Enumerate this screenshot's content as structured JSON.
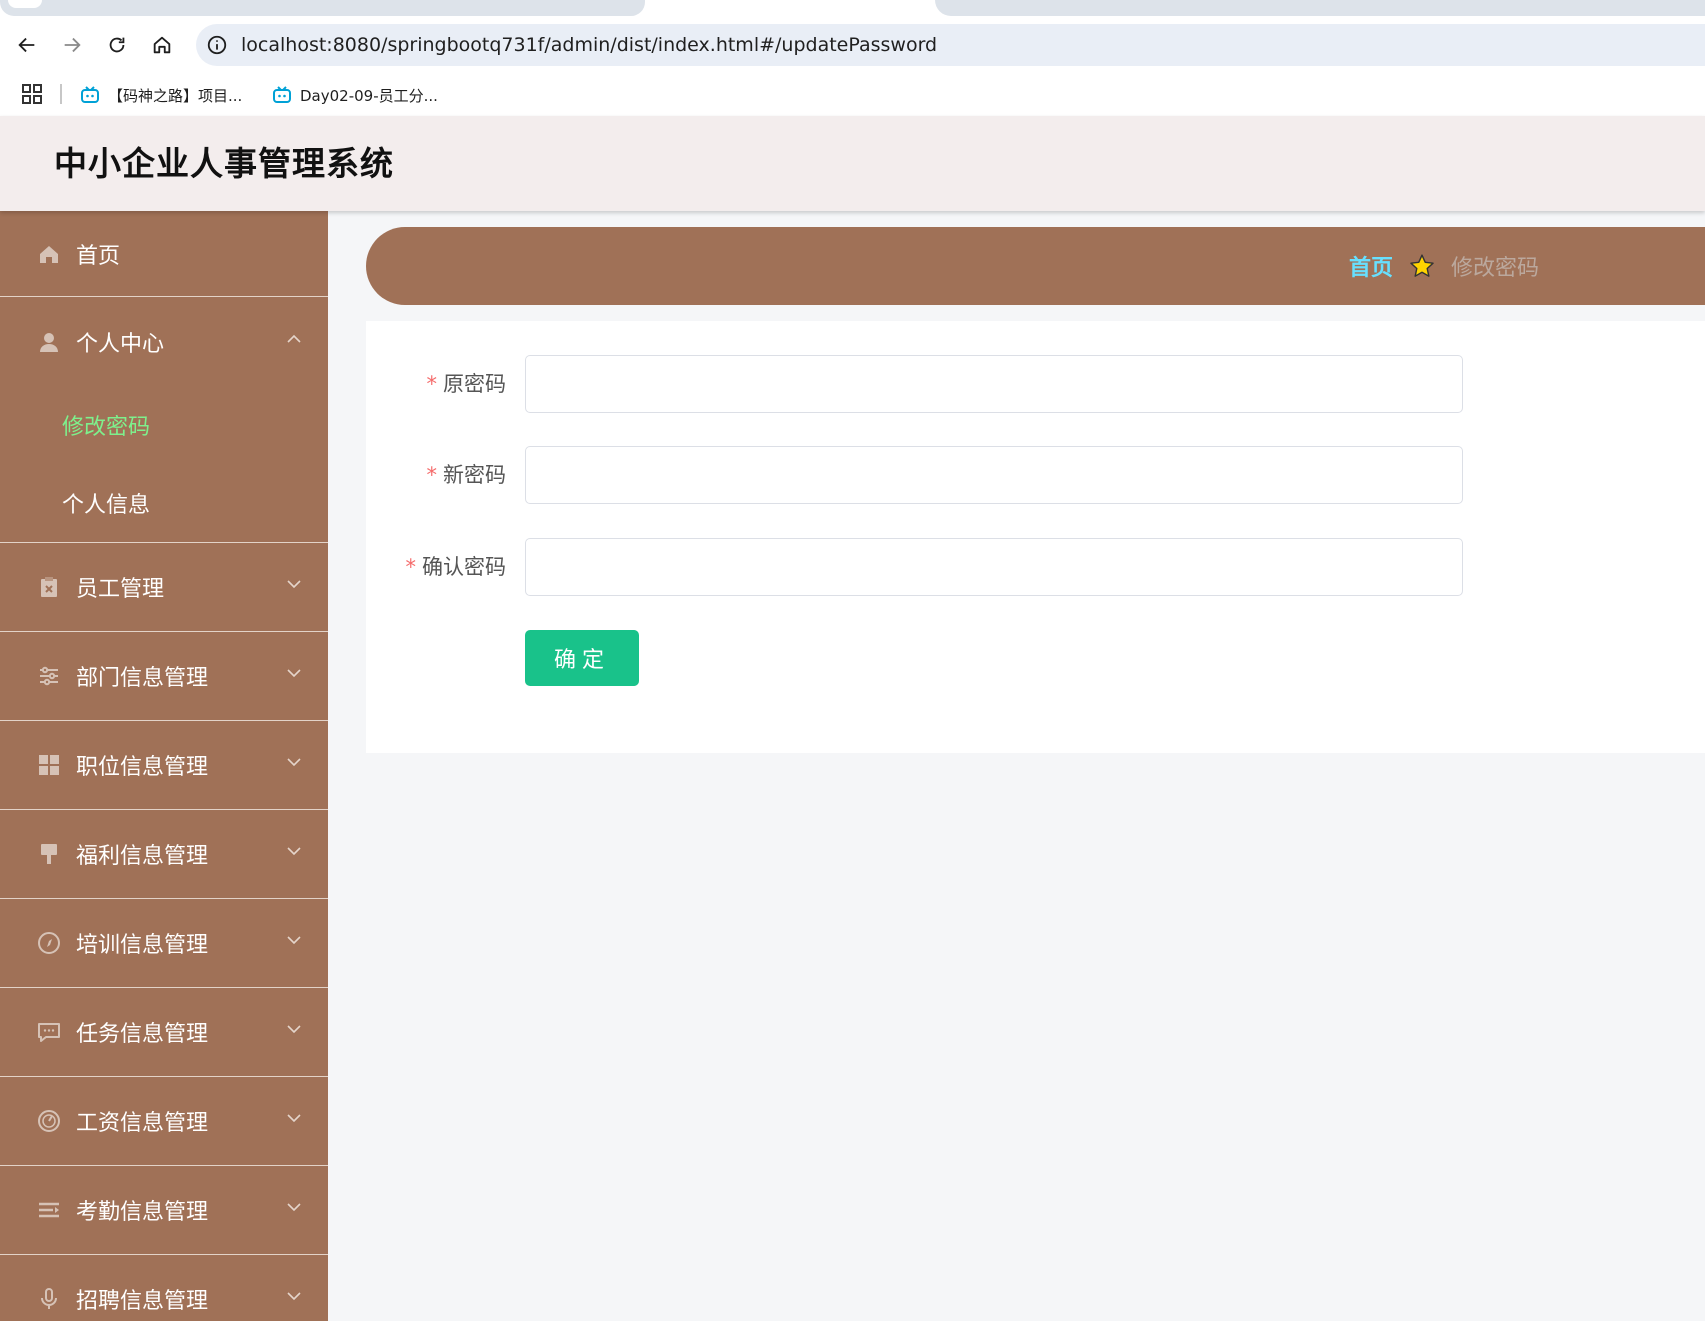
{
  "browser": {
    "url": "localhost:8080/springbootq731f/admin/dist/index.html#/updatePassword",
    "bookmarks": [
      {
        "label": "【码神之路】项目...",
        "icon": "bilibili-icon"
      },
      {
        "label": "Day02-09-员工分...",
        "icon": "bilibili-icon"
      }
    ]
  },
  "app": {
    "title": "中小企业人事管理系统"
  },
  "sidebar": {
    "home": "首页",
    "personal_center": {
      "label": "个人中心",
      "items": [
        {
          "label": "修改密码",
          "active": true
        },
        {
          "label": "个人信息",
          "active": false
        }
      ]
    },
    "menus": [
      {
        "label": "员工管理",
        "icon": "clipboard-icon"
      },
      {
        "label": "部门信息管理",
        "icon": "sliders-icon"
      },
      {
        "label": "职位信息管理",
        "icon": "grid-icon"
      },
      {
        "label": "福利信息管理",
        "icon": "brush-icon"
      },
      {
        "label": "培训信息管理",
        "icon": "compass-icon"
      },
      {
        "label": "任务信息管理",
        "icon": "message-icon"
      },
      {
        "label": "工资信息管理",
        "icon": "gauge-icon"
      },
      {
        "label": "考勤信息管理",
        "icon": "list-icon"
      },
      {
        "label": "招聘信息管理",
        "icon": "microphone-icon"
      }
    ]
  },
  "breadcrumb": {
    "home": "首页",
    "current": "修改密码"
  },
  "form": {
    "old_password_label": "原密码",
    "new_password_label": "新密码",
    "confirm_password_label": "确认密码",
    "required_mark": "*",
    "old_password_value": "",
    "new_password_value": "",
    "confirm_password_value": "",
    "submit_label": "确定"
  },
  "colors": {
    "sidebar_bg": "#a07157",
    "header_bg": "#f3eded",
    "active_menu_text": "#7ef08c",
    "breadcrumb_home": "#67e0ff",
    "submit_bg": "#19c28a",
    "required": "#f56c6c"
  }
}
